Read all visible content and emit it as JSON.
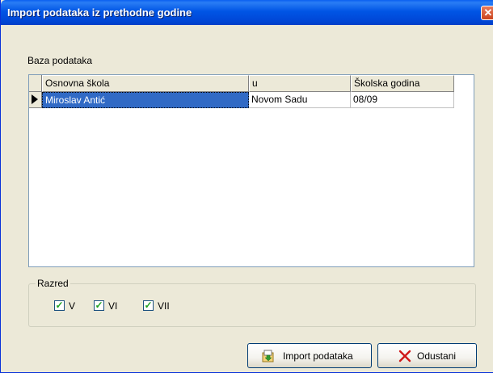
{
  "window": {
    "title": "Import podataka iz prethodne godine",
    "close_glyph": "✕"
  },
  "database_group": {
    "label": "Baza podataka",
    "columns": [
      "Osnovna škola",
      "u",
      "Školska godina"
    ],
    "rows": [
      {
        "school": "Miroslav Antić",
        "city": "Novom Sadu",
        "year": "08/09"
      }
    ]
  },
  "grade_group": {
    "label": "Razred",
    "options": [
      {
        "label": "V",
        "checked": true
      },
      {
        "label": "VI",
        "checked": true
      },
      {
        "label": "VII",
        "checked": true
      }
    ]
  },
  "buttons": {
    "import_label": "Import podataka",
    "import_icon": "import-icon",
    "cancel_label": "Odustani",
    "cancel_icon": "cancel-icon"
  }
}
